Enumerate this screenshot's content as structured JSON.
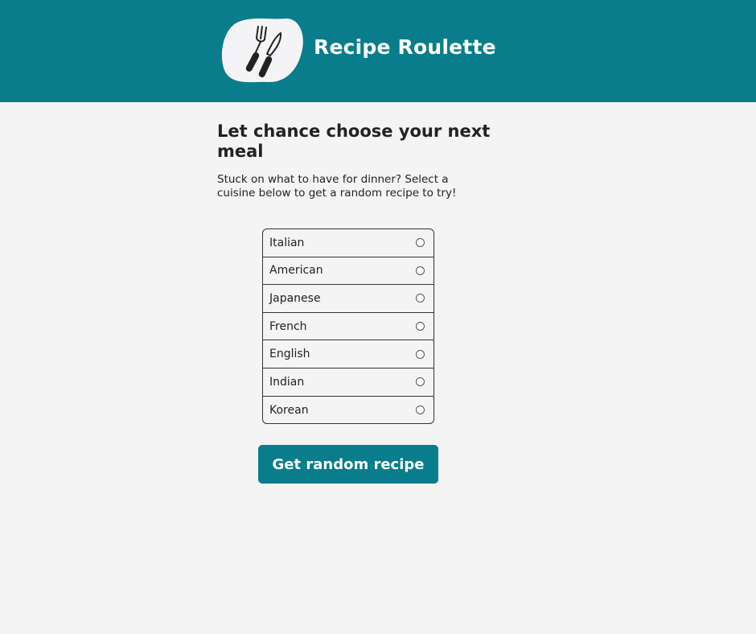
{
  "header": {
    "app_title": "Recipe Roulette",
    "logo_icon": "fork-and-knife-icon",
    "background_color": "#097d8b"
  },
  "main": {
    "heading": "Let chance choose your next meal",
    "intro": "Stuck on what to have for dinner? Select a cuisine below to get a random recipe to try!",
    "cuisines": [
      {
        "label": "Italian",
        "selected": false
      },
      {
        "label": "American",
        "selected": false
      },
      {
        "label": "Japanese",
        "selected": false
      },
      {
        "label": "French",
        "selected": false
      },
      {
        "label": "English",
        "selected": false
      },
      {
        "label": "Indian",
        "selected": false
      },
      {
        "label": "Korean",
        "selected": false
      }
    ],
    "submit_label": "Get random recipe",
    "accent_color": "#097d8b"
  }
}
